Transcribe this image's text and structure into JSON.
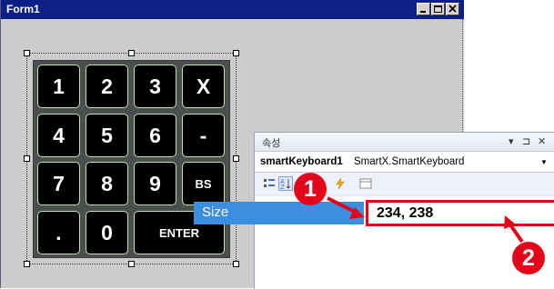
{
  "form": {
    "title": "Form1"
  },
  "keyboard": {
    "keys": [
      {
        "label": "1"
      },
      {
        "label": "2"
      },
      {
        "label": "3"
      },
      {
        "label": "X"
      },
      {
        "label": "4"
      },
      {
        "label": "5"
      },
      {
        "label": "6"
      },
      {
        "label": "-"
      },
      {
        "label": "7"
      },
      {
        "label": "8"
      },
      {
        "label": "9"
      },
      {
        "label": "BS"
      },
      {
        "label": "."
      },
      {
        "label": "0"
      },
      {
        "label": "ENTER"
      }
    ]
  },
  "properties": {
    "title": "속성",
    "controls": {
      "dropdown": "▾",
      "pin": "⊐",
      "close": "✕"
    },
    "object_name": "smartKeyboard1",
    "object_type": "SmartX.SmartKeyboard",
    "size_label": "Size",
    "size_value": "234, 238"
  },
  "callouts": {
    "one": "1",
    "two": "2"
  },
  "colors": {
    "titlebar": "#0b1f87",
    "selection": "#3c8ee0",
    "highlight": "#e3061a",
    "key_border": "#bfe3a8"
  }
}
